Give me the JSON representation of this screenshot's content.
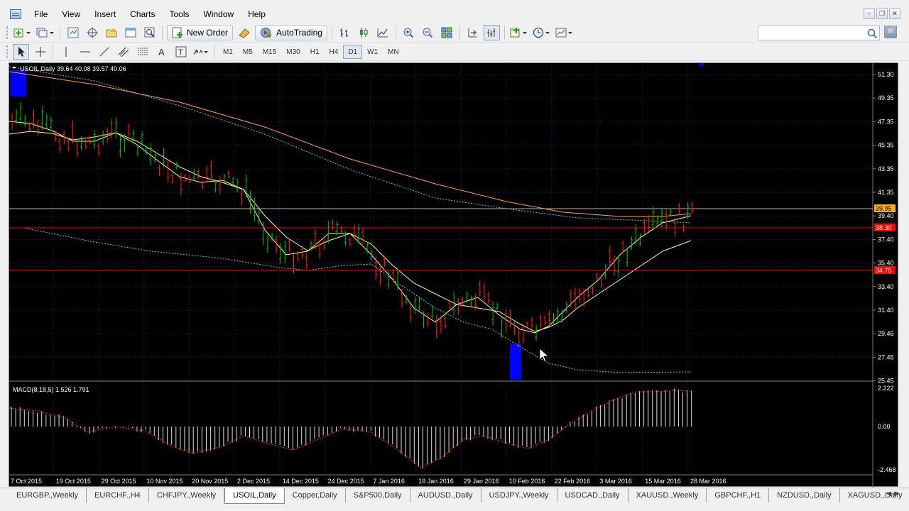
{
  "menu": {
    "items": [
      "File",
      "View",
      "Insert",
      "Charts",
      "Tools",
      "Window",
      "Help"
    ]
  },
  "window_controls": {
    "minimize": "–",
    "restore": "❐",
    "close": "✕"
  },
  "toolbar": {
    "new_order_label": "New Order",
    "autotrading_label": "AutoTrading",
    "timeframes": [
      "M1",
      "M5",
      "M15",
      "M30",
      "H1",
      "H4",
      "D1",
      "W1",
      "MN"
    ],
    "active_timeframe": "D1"
  },
  "search": {
    "value": "",
    "placeholder": ""
  },
  "mail_icon_glyph": "✉",
  "chart": {
    "header": "USOIL,Daily  39.64 40.08 39.57 40.06",
    "price_ticks": [
      "51.30",
      "49.35",
      "47.35",
      "45.35",
      "43.35",
      "41.35",
      "39.40",
      "37.40",
      "35.40",
      "33.40",
      "31.40",
      "29.45",
      "27.45",
      "25.45"
    ],
    "current_price_label": "39.95",
    "red_line_labels": [
      "38.30",
      "34.75"
    ],
    "date_labels": [
      "7 Oct 2015",
      "19 Oct 2015",
      "29 Oct 2015",
      "10 Nov 2015",
      "20 Nov 2015",
      "2 Dec 2015",
      "14 Dec 2015",
      "24 Dec 2015",
      "7 Jan 2016",
      "19 Jan 2016",
      "29 Jan 2016",
      "10 Feb 2016",
      "22 Feb 2016",
      "3 Mar 2016",
      "15 Mar 2016",
      "28 Mar 2016"
    ],
    "macd_header": "MACD(8,18,5) 1.526 1.791",
    "macd_ticks": [
      "2.222",
      "0.00",
      "-2.468"
    ],
    "colors": {
      "background": "#000000",
      "bull": "#00c000",
      "bear": "#ff2020",
      "ma_fast": "#ffff80",
      "ma_slow": "#ffa040",
      "ma_dotted": "#60d0d0",
      "level_line": "#ff0000",
      "highlight": "#0000ff"
    }
  },
  "tabs": [
    "EURGBP.,Weekly",
    "EURCHF.,H4",
    "CHFJPY.,Weekly",
    "USOIL,Daily",
    "Copper,Daily",
    "S&P500,Daily",
    "AUDUSD.,Daily",
    "USDJPY.,Weekly",
    "USDCAD.,Daily",
    "XAUUSD.,Weekly",
    "GBPCHF.,H1",
    "NZDUSD.,Daily",
    "XAGUSD.,Daily"
  ],
  "active_tab": "USOIL,Daily"
}
